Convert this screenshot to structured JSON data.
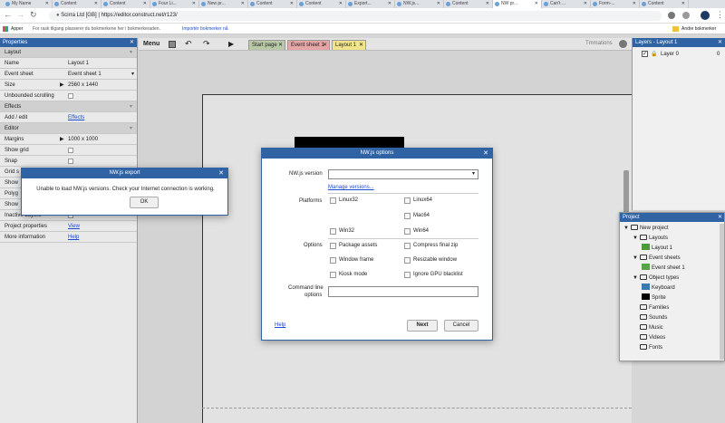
{
  "browser": {
    "tabs": [
      "My Name",
      "Content",
      "Content",
      "Four Li...",
      "New pr...",
      "Content",
      "Content",
      "Export...",
      "NW.js...",
      "Content",
      "NW pr...",
      "Can't ...",
      "Form-...",
      "Content"
    ],
    "active_tab": 10,
    "url_site": "Scirra Ltd [GB]",
    "url": "https://editor.construct.net/r123/",
    "apps_label": "Apper",
    "bookmark_hint": "For rask tilgang plasserer du bokmerkene her i bokmerkeraden.",
    "import_link": "Importér bokmerker nå",
    "other_bookmarks": "Andre bokmerker"
  },
  "menu": {
    "label": "Menu"
  },
  "editor_tabs": [
    {
      "label": "Start page",
      "color": "#b9c8a6"
    },
    {
      "label": "Event sheet 1",
      "color": "#e6a6a6"
    },
    {
      "label": "Layout 1",
      "color": "#f2e48a"
    }
  ],
  "toolbar": {
    "right_label": "Tmmations"
  },
  "properties": {
    "title": "Properties",
    "rows": [
      {
        "label": "Layout",
        "type": "section"
      },
      {
        "label": "Name",
        "value": "Layout 1"
      },
      {
        "label": "Event sheet",
        "value": "Event sheet 1",
        "dropdown": true
      },
      {
        "label": "Size",
        "value": "2560 x 1440",
        "expander": true
      },
      {
        "label": "Unbounded scrolling",
        "check": true
      },
      {
        "label": "Effects",
        "type": "section"
      },
      {
        "label": "Add / edit",
        "link": "Effects"
      },
      {
        "label": "Editor",
        "type": "section"
      },
      {
        "label": "Margins",
        "value": "1000 x 1000",
        "expander": true
      },
      {
        "label": "Show grid",
        "check": true
      },
      {
        "label": "Snap",
        "check": true
      },
      {
        "label": "Grid s",
        "check": false
      },
      {
        "label": "Show",
        "check": false
      },
      {
        "label": "Polyg",
        "check": false
      },
      {
        "label": "Show",
        "check": false
      },
      {
        "label": "Inactive Layers",
        "check": false
      },
      {
        "label": "Project properties",
        "link": "View"
      },
      {
        "label": "More information",
        "link": "Help"
      }
    ]
  },
  "layers": {
    "title": "Layers - Layout 1",
    "items": [
      "Layer 0"
    ],
    "count": "0"
  },
  "project": {
    "title": "Project",
    "items": [
      {
        "label": "New project",
        "lvl": 0,
        "icon": "folder"
      },
      {
        "label": "Layouts",
        "lvl": 1,
        "icon": "folder"
      },
      {
        "label": "Layout 1",
        "lvl": 2,
        "icon": "layout"
      },
      {
        "label": "Event sheets",
        "lvl": 1,
        "icon": "folder"
      },
      {
        "label": "Event sheet 1",
        "lvl": 2,
        "icon": "sheet"
      },
      {
        "label": "Object types",
        "lvl": 1,
        "icon": "folder"
      },
      {
        "label": "Keyboard",
        "lvl": 2,
        "icon": "keyboard"
      },
      {
        "label": "Sprite",
        "lvl": 2,
        "icon": "sprite"
      },
      {
        "label": "Families",
        "lvl": 1,
        "icon": "folder"
      },
      {
        "label": "Sounds",
        "lvl": 1,
        "icon": "folder"
      },
      {
        "label": "Music",
        "lvl": 1,
        "icon": "folder"
      },
      {
        "label": "Videos",
        "lvl": 1,
        "icon": "folder"
      },
      {
        "label": "Fonts",
        "lvl": 1,
        "icon": "folder"
      }
    ]
  },
  "error_dialog": {
    "title": "NW.js export",
    "message": "Unable to load NW.js versions. Check your Internet connection is working.",
    "ok": "OK"
  },
  "nw_dialog": {
    "title": "NW.js options",
    "version_label": "NW.js version",
    "version_value": "",
    "manage_link": "Manage versions...",
    "platforms_label": "Platforms",
    "platforms": [
      "Linux32",
      "Linux64",
      "Mac64",
      "Win32",
      "Win64"
    ],
    "options_label": "Options",
    "options": [
      "Package assets",
      "Compress final zip",
      "Window frame",
      "Resizable window",
      "Kiosk mode",
      "Ignore GPU blacklist"
    ],
    "cmdline_label_1": "Command line",
    "cmdline_label_2": "options",
    "cmdline_value": "",
    "help": "Help",
    "next": "Next",
    "cancel": "Cancel"
  }
}
